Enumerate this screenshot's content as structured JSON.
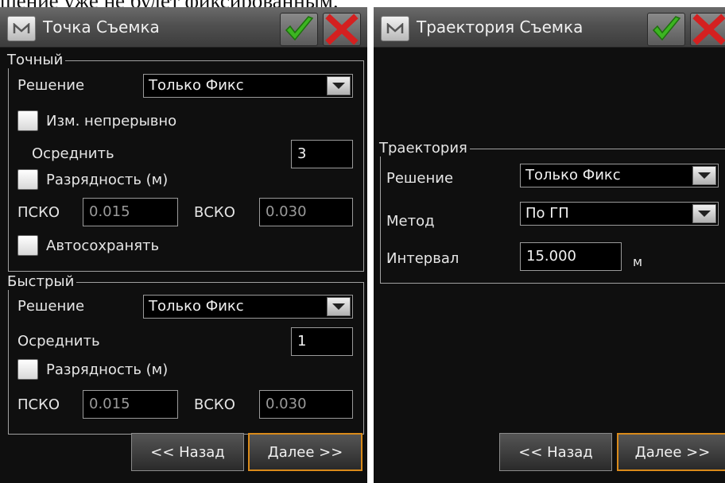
{
  "doc_text": "шение уже не будет фиксированным.",
  "left_panel": {
    "title": "Точка Съемка",
    "precise": {
      "legend": "Точный",
      "solution_label": "Решение",
      "solution_value": "Только Фикс",
      "continuous_label": "Изм. непрерывно",
      "average_label": "Осреднить",
      "average_value": "3",
      "bits_label": "Разрядность (м)",
      "psko_label": "ПСКО",
      "psko_value": "0.015",
      "vsko_label": "ВСКО",
      "vsko_value": "0.030",
      "autosave_label": "Автосохранять"
    },
    "fast": {
      "legend": "Быстрый",
      "solution_label": "Решение",
      "solution_value": "Только Фикс",
      "average_label": "Осреднить",
      "average_value": "1",
      "bits_label": "Разрядность (м)",
      "psko_label": "ПСКО",
      "psko_value": "0.015",
      "vsko_label": "ВСКО",
      "vsko_value": "0.030"
    },
    "back_label": "<< Назад",
    "next_label": "Далее >>"
  },
  "right_panel": {
    "title": "Траектория Съемка",
    "trajectory": {
      "legend": "Траектория",
      "solution_label": "Решение",
      "solution_value": "Только Фикс",
      "method_label": "Метод",
      "method_value": "По ГП",
      "interval_label": "Интервал",
      "interval_value": "15.000",
      "interval_unit": "м"
    },
    "back_label": "<< Назад",
    "next_label": "Далее >>"
  },
  "icons": {
    "app_logo": "m-logo-icon",
    "ok": "green-check-icon",
    "cancel": "red-x-icon",
    "dropdown": "chevron-down-icon"
  },
  "colors": {
    "panel_bg": "#0f0f0f",
    "accent_border": "#d98a1a",
    "ok_green": "#3cb521",
    "cancel_red": "#d42020"
  }
}
